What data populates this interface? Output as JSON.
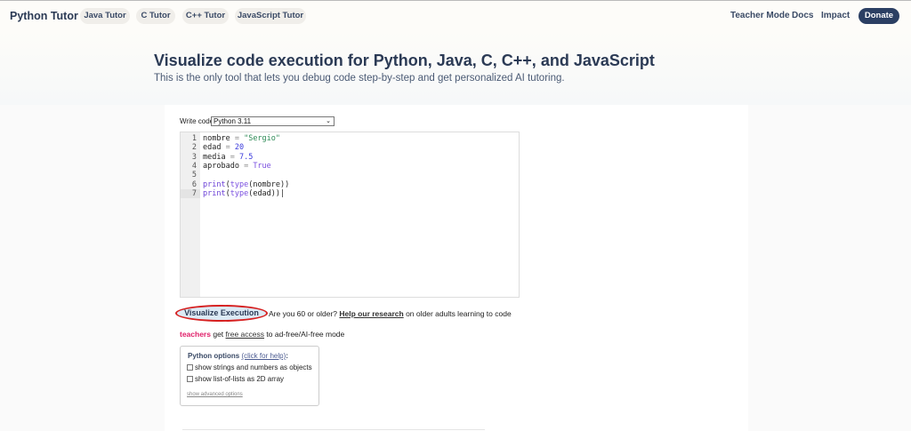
{
  "header": {
    "brand": "Python Tutor",
    "tabs": [
      "Java Tutor",
      "C Tutor",
      "C++ Tutor",
      "JavaScript Tutor"
    ],
    "links": [
      "Teacher Mode",
      "Docs",
      "Impact"
    ],
    "donate": "Donate"
  },
  "hero": {
    "title": "Visualize code execution for Python, Java, C, C++, and JavaScript",
    "subtitle": "This is the only tool that lets you debug code step-by-step and get personalized AI tutoring."
  },
  "editor": {
    "label": "Write code in",
    "language": "Python 3.11",
    "line_numbers": [
      "1",
      "2",
      "3",
      "4",
      "5",
      "6",
      "7"
    ]
  },
  "actions": {
    "visualize": "Visualize Execution",
    "research_pre": "Are you 60 or older?",
    "research_link": "Help our research",
    "research_post": "on older adults learning to code",
    "teachers": "teachers",
    "get": "get",
    "free_access": "free access",
    "mode": "to ad-free/AI-free mode"
  },
  "options": {
    "title": "Python options",
    "help": "(click for help)",
    "colon": ":",
    "opt1": "show strings and numbers as objects",
    "opt2": "show list-of-lists as 2D array",
    "advanced": "show advanced options"
  }
}
